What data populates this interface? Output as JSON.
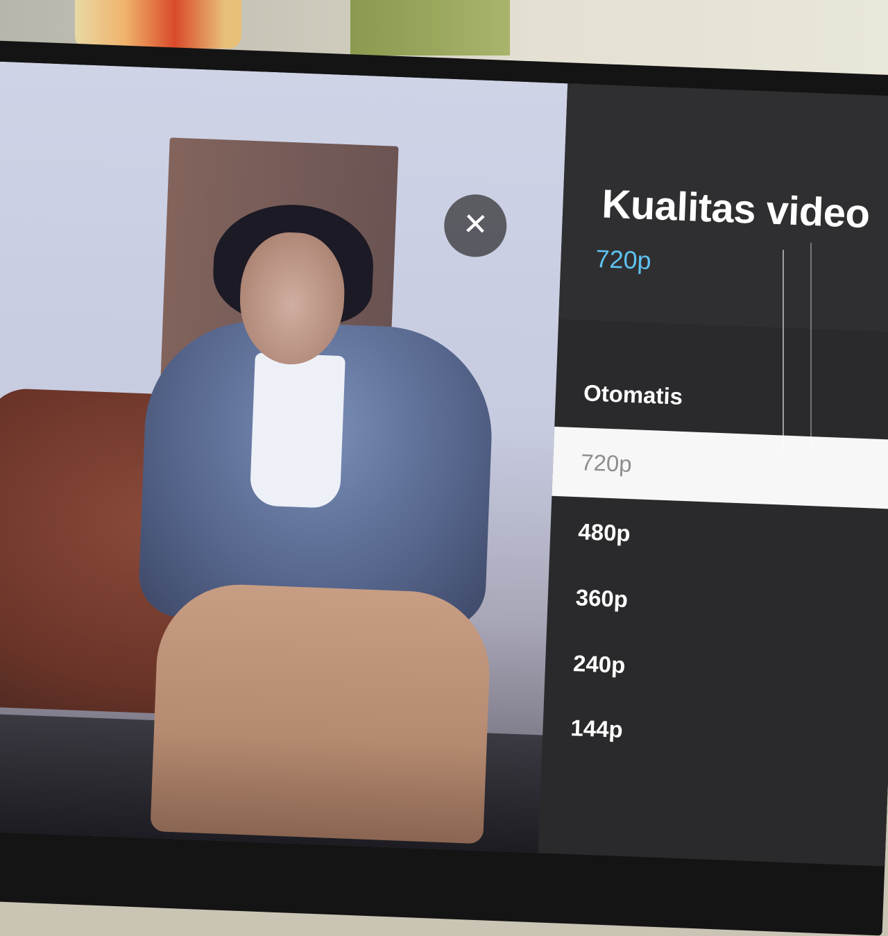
{
  "dialog": {
    "title": "Kualitas video",
    "current": "720p",
    "close_symbol": "✕"
  },
  "options": [
    {
      "label": "Otomatis"
    },
    {
      "label": "720p"
    },
    {
      "label": "480p"
    },
    {
      "label": "360p"
    },
    {
      "label": "240p"
    },
    {
      "label": "144p"
    }
  ],
  "selected_index": 1,
  "colors": {
    "accent": "#5ec3f0",
    "panel": "#2a2a2c",
    "selected_bg": "#f7f7f7"
  }
}
